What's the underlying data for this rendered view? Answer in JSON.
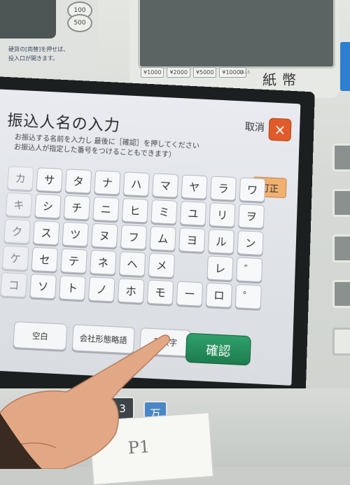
{
  "coin_panel": {
    "buttons": [
      "100",
      "500"
    ],
    "note_tag": "両替",
    "note_line1": "硬貨の[両替]を押せば、",
    "note_line2": "投入口が開きます。"
  },
  "bill_panel": {
    "chips": [
      "¥1000",
      "¥2000",
      "¥5000",
      "¥10000"
    ],
    "bills_label": "BILLS",
    "kanji": "紙幣"
  },
  "screen": {
    "title": "振込人名の入力",
    "instruction_1": "お振込する名前を入力し 最後に［確認］を押してください",
    "instruction_2": "お振込人が指定した番号をつけることもできます）",
    "cancel_label": "取消",
    "cancel_icon": "×",
    "correct_label": "訂正",
    "kana_keys": [
      [
        "カ",
        "サ",
        "タ",
        "ナ",
        "ハ",
        "マ",
        "ヤ",
        "ラ",
        "ワ",
        ""
      ],
      [
        "キ",
        "シ",
        "チ",
        "ニ",
        "ヒ",
        "ミ",
        "ユ",
        "リ",
        "ヲ",
        ""
      ],
      [
        "ク",
        "ス",
        "ツ",
        "ヌ",
        "フ",
        "ム",
        "ヨ",
        "ル",
        "ン",
        ""
      ],
      [
        "ケ",
        "セ",
        "テ",
        "ネ",
        "ヘ",
        "メ",
        "",
        "レ",
        "゛",
        ""
      ],
      [
        "コ",
        "ソ",
        "ト",
        "ノ",
        "ホ",
        "モ",
        "ー",
        "ロ",
        "゜",
        ""
      ]
    ],
    "bottom_keys": [
      "空白",
      "会社形態略語",
      "英数字"
    ],
    "confirm_label": "確認"
  },
  "keypad": {
    "num_key": "3",
    "man_key": "万"
  },
  "paper": {
    "text": "P1"
  }
}
